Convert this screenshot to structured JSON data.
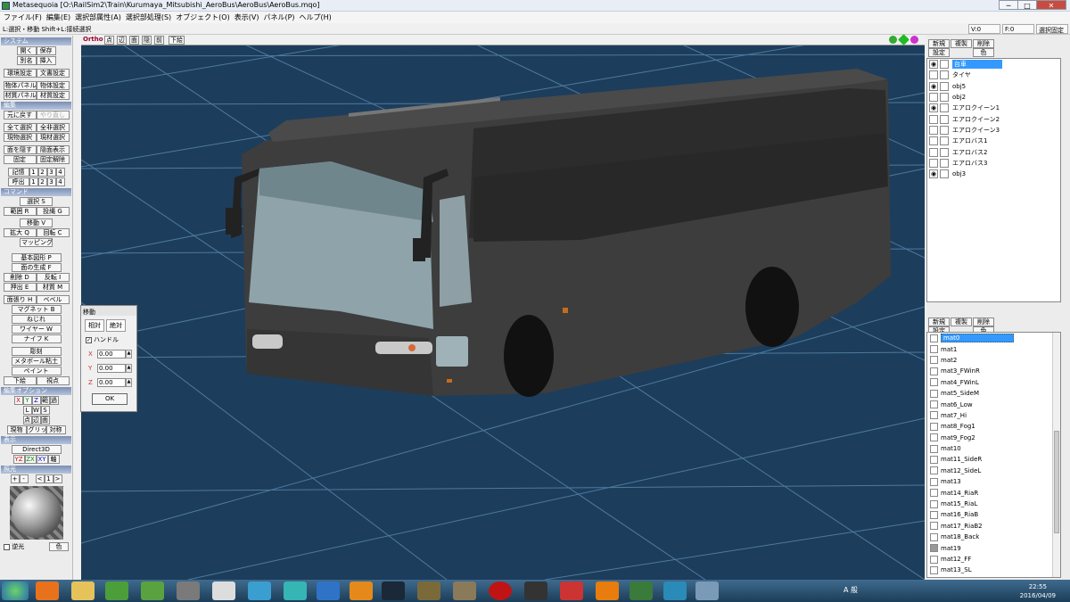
{
  "window": {
    "title": "Metasequoia [O:\\RailSim2\\Train\\Kurumaya_Mitsubishi_AeroBus\\AeroBus\\AeroBus.mqo]",
    "min": "─",
    "max": "□",
    "close": "✕"
  },
  "menu": [
    "ファイル(F)",
    "編集(E)",
    "選択部属性(A)",
    "選択部処理(S)",
    "オブジェクト(O)",
    "表示(V)",
    "パネル(P)",
    "ヘルプ(H)"
  ],
  "status": {
    "hint": "L:選択・移動  Shift+L:接続選択",
    "v": "V:0",
    "f": "F:0",
    "release": "選択固定"
  },
  "left": {
    "system": {
      "title": "システム",
      "rows": [
        [
          "開く",
          "保存"
        ],
        [
          "別名",
          "挿入"
        ],
        [
          "環境設定",
          "文書設定"
        ],
        [
          "物体パネル",
          "物体設定"
        ],
        [
          "材質パネル",
          "材質設定"
        ]
      ]
    },
    "edit": {
      "title": "編集",
      "rows": [
        [
          "元に戻す",
          "やり直し"
        ],
        [
          "全て選択",
          "全非選択"
        ],
        [
          "現物選択",
          "現材選択"
        ],
        [
          "面を隠す",
          "隠面表示"
        ],
        [
          "固定",
          "固定解除"
        ]
      ],
      "memory": "記憶",
      "recall": "呼出",
      "nums": [
        "1",
        "2",
        "3",
        "4"
      ]
    },
    "command": {
      "title": "コマンド",
      "items": [
        [
          "選択 S"
        ],
        [
          "範囲 R",
          "投縄 G"
        ],
        [
          "移動 V"
        ],
        [
          "拡大 Q",
          "回転 C"
        ],
        [
          "マッピング"
        ],
        [
          "基本図形 P"
        ],
        [
          "面の生成 F"
        ],
        [
          "削除 D",
          "反転 I"
        ],
        [
          "押出 E",
          "材質 M"
        ],
        [
          "面張り H",
          "ベベル"
        ],
        [
          "マグネット B"
        ],
        [
          "ねじれ"
        ],
        [
          "ワイヤー W"
        ],
        [
          "ナイフ K"
        ],
        [
          "彫刻"
        ],
        [
          "メタボール粘土"
        ],
        [
          "ペイント"
        ],
        [
          "下絵",
          "視点"
        ]
      ]
    },
    "editopt": {
      "title": "編集オプション",
      "r1": [
        "X",
        "Y",
        "Z",
        "範",
        "過"
      ],
      "r2": [
        "L",
        "W",
        "S"
      ],
      "r3": [
        "点",
        "辺",
        "面"
      ],
      "r4": [
        "現物",
        "グリッド",
        "対称"
      ]
    },
    "display": {
      "title": "表示",
      "d3d": "Direct3D",
      "axes": [
        "YZ",
        "ZX",
        "XY",
        "軸"
      ]
    },
    "light": {
      "title": "照光",
      "controls": [
        "+",
        "-",
        "<",
        "1",
        ">"
      ],
      "back": "逆光",
      "color": "色"
    }
  },
  "viewtool": {
    "ortho": "Ortho",
    "buttons": [
      "点",
      "辺",
      "面",
      "隠",
      "前",
      "下絵"
    ]
  },
  "movedlg": {
    "title": "移動",
    "tab1": "相対",
    "tab2": "絶対",
    "handle": "ハンドル",
    "fields": [
      {
        "axis": "X",
        "value": "0.00"
      },
      {
        "axis": "Y",
        "value": "0.00"
      },
      {
        "axis": "Z",
        "value": "0.00"
      }
    ],
    "ok": "OK"
  },
  "objpanel": {
    "buttons": [
      "新規",
      "複製",
      "削除",
      "設定",
      "色"
    ],
    "items": [
      {
        "name": "台車",
        "eye": true,
        "sel": true
      },
      {
        "name": "タイヤ",
        "eye": false
      },
      {
        "name": "obj5",
        "eye": true
      },
      {
        "name": "obj2",
        "eye": false
      },
      {
        "name": "エアロクイーン1",
        "eye": true
      },
      {
        "name": "エアロクイーン2",
        "eye": false
      },
      {
        "name": "エアロクイーン3",
        "eye": false
      },
      {
        "name": "エアロバス1",
        "eye": false
      },
      {
        "name": "エアロバス2",
        "eye": false
      },
      {
        "name": "エアロバス3",
        "eye": false
      },
      {
        "name": "obj3",
        "eye": true
      }
    ]
  },
  "matpanel": {
    "buttons": [
      "新規",
      "複製",
      "削除",
      "設定",
      "色"
    ],
    "items": [
      "mat0",
      "mat1",
      "mat2",
      "mat3_FWinR",
      "mat4_FWinL",
      "mat5_SideM",
      "mat6_Low",
      "mat7_Hi",
      "mat8_Fog1",
      "mat9_Fog2",
      "mat10",
      "mat11_SideR",
      "mat12_SideL",
      "mat13",
      "mat14_RiaR",
      "mat15_RiaL",
      "mat16_RiaB",
      "mat17_RiaB2",
      "mat18_Back",
      "mat19",
      "mat12_FF",
      "mat13_SL"
    ]
  },
  "taskbar": {
    "time": "22:55",
    "date": "2016/04/09",
    "ime": "A 般"
  },
  "colors": {
    "viewport": "#1d3d5c",
    "grid": "#5d8fb4",
    "bus": "#3c3c3c",
    "selection": "#3399ff"
  }
}
